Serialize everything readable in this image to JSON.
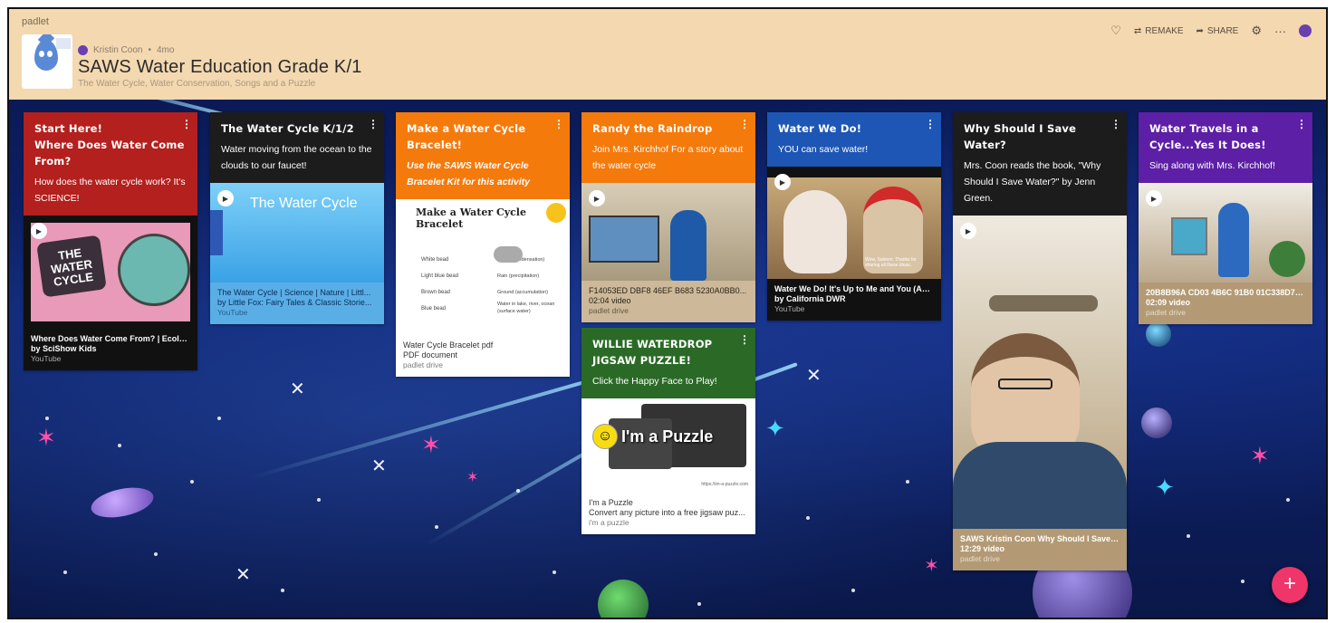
{
  "header": {
    "brand": "padlet",
    "author": "Kristin Coon",
    "age": "4mo",
    "title": "SAWS Water Education Grade K/1",
    "subtitle": "The Water Cycle, Water Conservation, Songs and a Puzzle",
    "actions": {
      "remake": "REMAKE",
      "share": "SHARE"
    }
  },
  "icons": [
    "heart-icon",
    "remake-icon",
    "share-icon",
    "gear-icon",
    "more-icon",
    "avatar",
    "plus-icon",
    "play-icon"
  ],
  "colors": {
    "header_bg": "#f3d8b0",
    "red": "#b3201e",
    "dark": "#1c1c1c",
    "orange": "#f47a0c",
    "blue": "#1d56b4",
    "green": "#2a6a26",
    "purple": "#5d1fa5",
    "tan": "#cdb99a",
    "fab": "#f0356a"
  },
  "columns": [
    {
      "cards": [
        {
          "title": "Start Here!\nWhere Does Water Come From?",
          "body": "How does the water cycle work? It's SCIENCE!",
          "thumb_text": "THE WATER CYCLE",
          "att_title": "Where Does Water Come From? | Ecolog...",
          "att_sub": "by SciShow Kids",
          "att_src": "YouTube"
        }
      ]
    },
    {
      "cards": [
        {
          "title": "The Water Cycle K/1/2",
          "body": "Water moving from the ocean to the clouds to our faucet!",
          "thumb_text": "The Water Cycle",
          "att_title": "The Water Cycle | Science | Nature | Littl...",
          "att_sub": "by Little Fox: Fairy Tales & Classic Storie...",
          "att_src": "YouTube"
        }
      ]
    },
    {
      "cards": [
        {
          "title": "Make a Water Cycle Bracelet!",
          "body": "Use the SAWS Water Cycle Bracelet Kit for this activity",
          "thumb_text": "Make a Water Cycle Bracelet",
          "legend": [
            "White bead",
            "Light blue bead",
            "Brown bead",
            "Blue bead"
          ],
          "legend_right": [
            "Cloud (condensation)",
            "Rain (precipitation)",
            "Ground (accumulation)",
            "Water in lake, river, ocean (surface water)"
          ],
          "att_title": "Water Cycle Bracelet pdf",
          "att_sub": "PDF document",
          "att_src": "padlet drive"
        }
      ]
    },
    {
      "cards": [
        {
          "title": "Randy the Raindrop",
          "body": "Join Mrs. Kirchhof For a story about the water cycle",
          "att_title": "F14053ED DBF8 46EF B683 5230A0BB0...",
          "att_sub": "02:04 video",
          "att_src": "padlet drive"
        },
        {
          "title": "WILLIE WATERDROP JIGSAW PUZZLE!",
          "body": "Click the Happy Face to Play!",
          "thumb_text": "I'm a Puzzle",
          "thumb_url": "https://im-a-puzzle.com",
          "att_title": "I'm a Puzzle",
          "att_sub": "Convert any picture into a free jigsaw puz...",
          "att_src": "i'm a puzzle"
        }
      ]
    },
    {
      "cards": [
        {
          "title": "Water We Do!",
          "body": "YOU can save water!",
          "caption": "Wow, Salmon. Thanks for sharing all these ideas.",
          "att_title": "Water We Do! It's Up to Me and You (Abri...",
          "att_sub": "by California DWR",
          "att_src": "YouTube"
        }
      ]
    },
    {
      "cards": [
        {
          "title": "Why Should I Save Water?",
          "body": "Mrs. Coon reads the book, \"Why Should I Save Water?\" by Jenn Green.",
          "att_title": "SAWS Kristin Coon Why Should I Save W...",
          "att_sub": "12:29 video",
          "att_src": "padlet drive"
        }
      ]
    },
    {
      "cards": [
        {
          "title": "Water Travels in a Cycle...Yes It Does!",
          "body": "Sing along with Mrs. Kirchhof!",
          "att_title": "20B8B96A CD03 4B6C 91B0 01C338D7B...",
          "att_sub": "02:09 video",
          "att_src": "padlet drive"
        }
      ]
    }
  ]
}
